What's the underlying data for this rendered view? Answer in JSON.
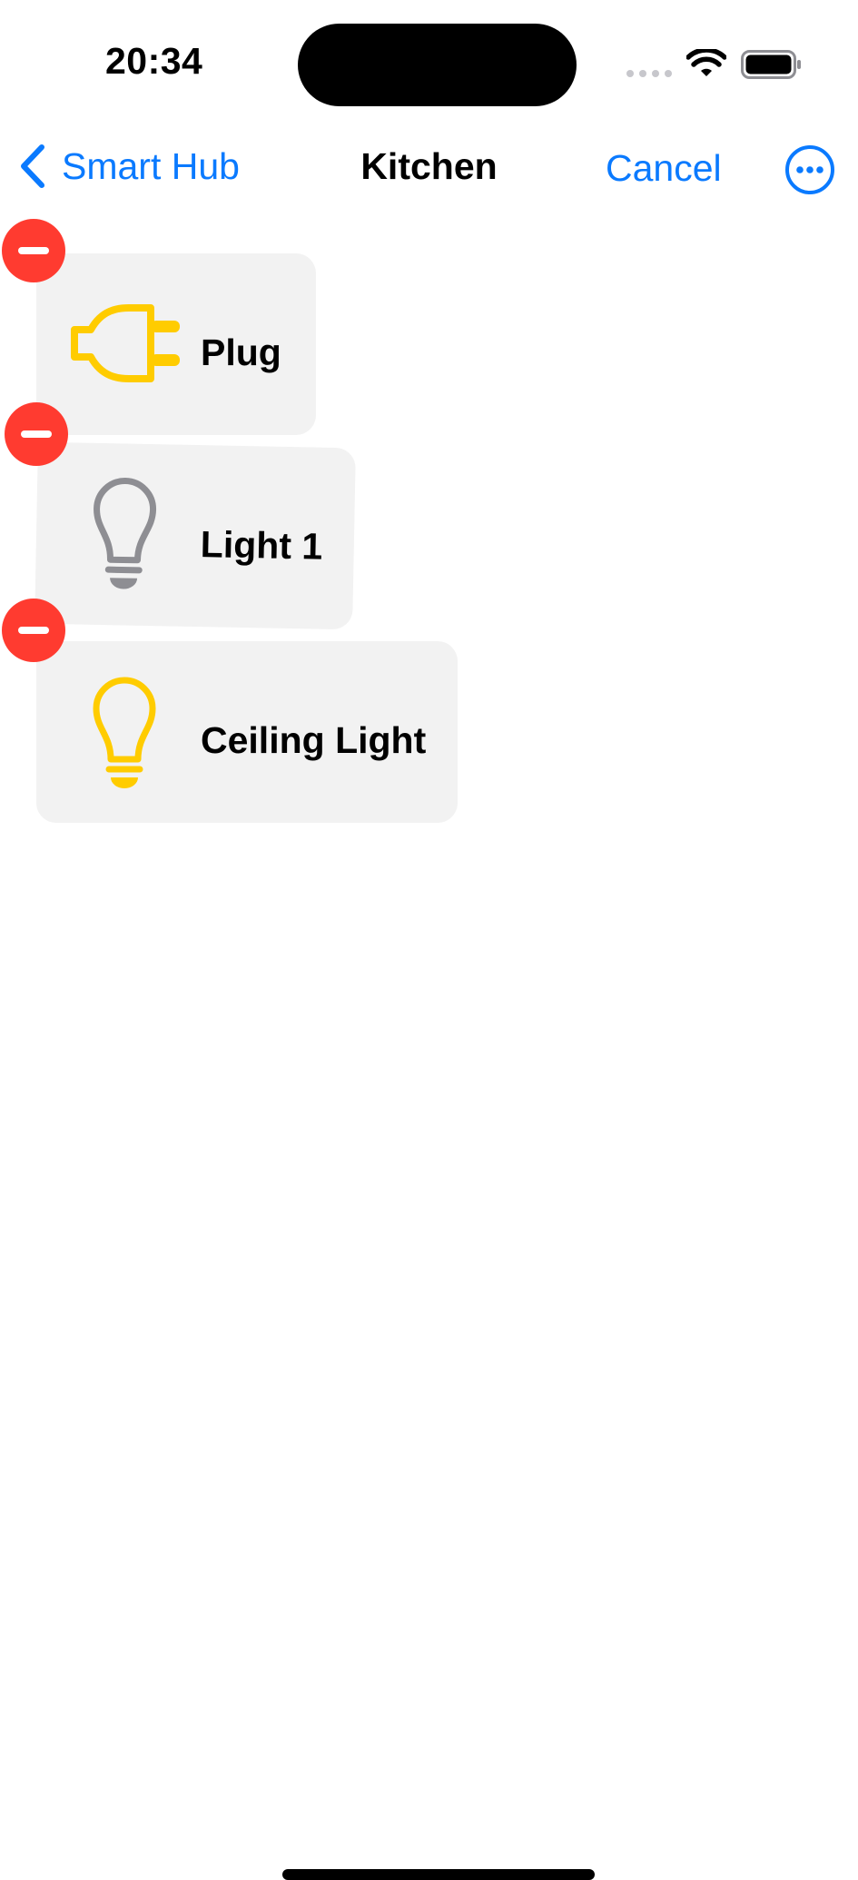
{
  "status_bar": {
    "time": "20:34",
    "icons": [
      "signal-dots-icon",
      "wifi-icon",
      "battery-icon"
    ]
  },
  "nav": {
    "back_label": "Smart Hub",
    "title": "Kitchen",
    "cancel_label": "Cancel",
    "more_icon": "ellipsis-circle-icon"
  },
  "accessories": [
    {
      "name": "Plug",
      "icon": "plug-icon",
      "icon_color": "#FFCC00"
    },
    {
      "name": "Light 1",
      "icon": "lightbulb-icon",
      "icon_color": "#8E8E93"
    },
    {
      "name": "Ceiling Light",
      "icon": "lightbulb-icon",
      "icon_color": "#FFCC00"
    }
  ],
  "colors": {
    "accent": "#0A7AFF",
    "delete": "#FF3B30",
    "tile_bg": "#F2F2F2",
    "icon_on": "#FFCC00",
    "icon_off": "#8E8E93"
  }
}
